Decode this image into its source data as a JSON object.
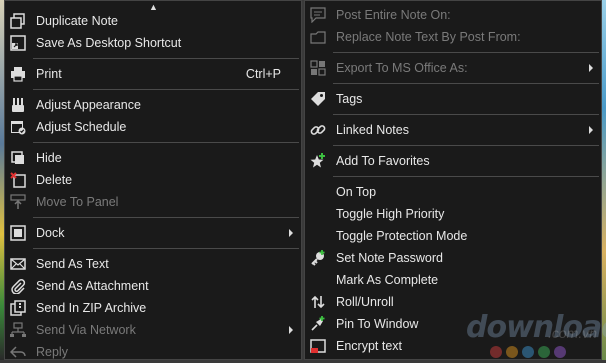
{
  "colors": {
    "menu_bg": "#1a1a1a",
    "text": "#e8e8e8",
    "disabled_text": "#7a7a7a",
    "separator": "#4a4a4a"
  },
  "left_menu": {
    "scroll_indicator": "▲",
    "items": [
      {
        "label": "Duplicate Note",
        "icon": "duplicate-icon"
      },
      {
        "label": "Save As Desktop Shortcut",
        "icon": "shortcut-icon"
      },
      {
        "label": "Print",
        "shortcut": "Ctrl+P",
        "icon": "printer-icon"
      },
      {
        "label": "Adjust Appearance",
        "icon": "appearance-icon"
      },
      {
        "label": "Adjust Schedule",
        "icon": "calendar-icon"
      },
      {
        "label": "Hide",
        "icon": "hide-icon"
      },
      {
        "label": "Delete",
        "icon": "delete-icon"
      },
      {
        "label": "Move To Panel",
        "icon": "move-panel-icon",
        "disabled": true
      },
      {
        "label": "Dock",
        "icon": "dock-icon",
        "submenu": true
      },
      {
        "label": "Send As Text",
        "icon": "envelope-icon"
      },
      {
        "label": "Send As Attachment",
        "icon": "paperclip-icon"
      },
      {
        "label": "Send In ZIP Archive",
        "icon": "zip-icon"
      },
      {
        "label": "Send Via Network",
        "icon": "network-icon",
        "disabled": true,
        "submenu": true
      },
      {
        "label": "Reply",
        "icon": "reply-icon",
        "disabled": true
      }
    ]
  },
  "right_menu": {
    "items": [
      {
        "label": "Post Entire Note On:",
        "icon": "post-icon",
        "disabled": true
      },
      {
        "label": "Replace Note Text By Post From:",
        "icon": "replace-icon",
        "disabled": true
      },
      {
        "label": "Export To MS Office As:",
        "icon": "office-icon",
        "disabled": true,
        "submenu": true
      },
      {
        "label": "Tags",
        "icon": "tag-icon"
      },
      {
        "label": "Linked Notes",
        "icon": "link-icon",
        "submenu": true
      },
      {
        "label": "Add To Favorites",
        "icon": "star-icon"
      },
      {
        "label": "On Top"
      },
      {
        "label": "Toggle High Priority"
      },
      {
        "label": "Toggle Protection Mode"
      },
      {
        "label": "Set Note Password",
        "icon": "key-icon"
      },
      {
        "label": "Mark As Complete"
      },
      {
        "label": "Roll/Unroll",
        "icon": "roll-icon"
      },
      {
        "label": "Pin To Window",
        "icon": "pin-icon"
      },
      {
        "label": "Encrypt text",
        "icon": "encrypt-icon"
      }
    ]
  },
  "watermark": {
    "text": "download",
    "domain": ".com.vn"
  }
}
